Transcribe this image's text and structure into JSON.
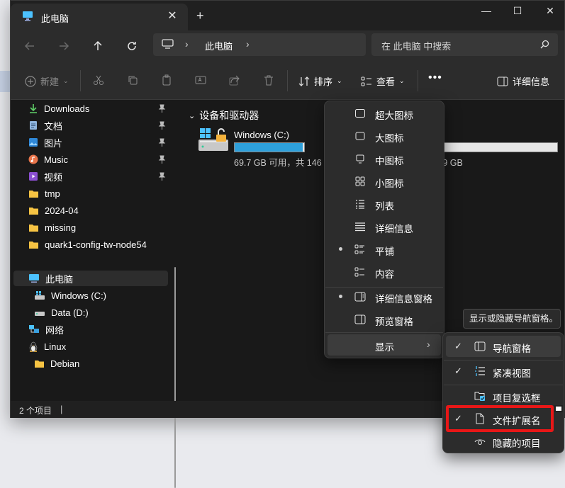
{
  "window": {
    "tab_title": "此电脑",
    "minimize": "—",
    "maximize": "☐",
    "close": "✕",
    "new_tab": "+"
  },
  "address": {
    "crumb": "此电脑",
    "search_placeholder": "在 此电脑 中搜索"
  },
  "toolbar": {
    "new_label": "新建",
    "sort_label": "排序",
    "view_label": "查看",
    "more_label": "•••",
    "details_label": "详细信息"
  },
  "sidebar": {
    "items": [
      {
        "label": "Downloads"
      },
      {
        "label": "文档"
      },
      {
        "label": "图片"
      },
      {
        "label": "Music"
      },
      {
        "label": "视频"
      },
      {
        "label": "tmp"
      },
      {
        "label": "2024-04"
      },
      {
        "label": "missing"
      },
      {
        "label": "quark1-config-tw-node54"
      },
      {
        "label": "此电脑"
      },
      {
        "label": "Windows (C:)"
      },
      {
        "label": "Data (D:)"
      },
      {
        "label": "网络"
      },
      {
        "label": "Linux"
      },
      {
        "label": "Debian"
      }
    ]
  },
  "main": {
    "group_title": "设备和驱动器",
    "drives": [
      {
        "name": "Windows (C:)",
        "space": "69.7 GB 可用，共 146",
        "used_fraction": 0.52
      },
      {
        "name": ":)",
        "space": "，共 329 GB",
        "used_fraction": 0.52
      }
    ]
  },
  "status": {
    "count": "2 个项目"
  },
  "view_menu": {
    "items": [
      {
        "label": "超大图标"
      },
      {
        "label": "大图标"
      },
      {
        "label": "中图标"
      },
      {
        "label": "小图标"
      },
      {
        "label": "列表"
      },
      {
        "label": "详细信息"
      },
      {
        "label": "平铺"
      },
      {
        "label": "内容"
      },
      {
        "label": "详细信息窗格"
      },
      {
        "label": "预览窗格"
      },
      {
        "label": "显示"
      }
    ]
  },
  "show_submenu": {
    "items": [
      {
        "label": "导航窗格",
        "checked": true
      },
      {
        "label": "紧凑视图",
        "checked": true
      },
      {
        "label": "项目复选框",
        "checked": false
      },
      {
        "label": "文件扩展名",
        "checked": true
      },
      {
        "label": "隐藏的项目",
        "checked": false
      }
    ]
  },
  "tooltip": "显示或隐藏导航窗格。",
  "colors": {
    "accent": "#2ea0db",
    "highlight": "#e81717",
    "background": "#191919"
  }
}
